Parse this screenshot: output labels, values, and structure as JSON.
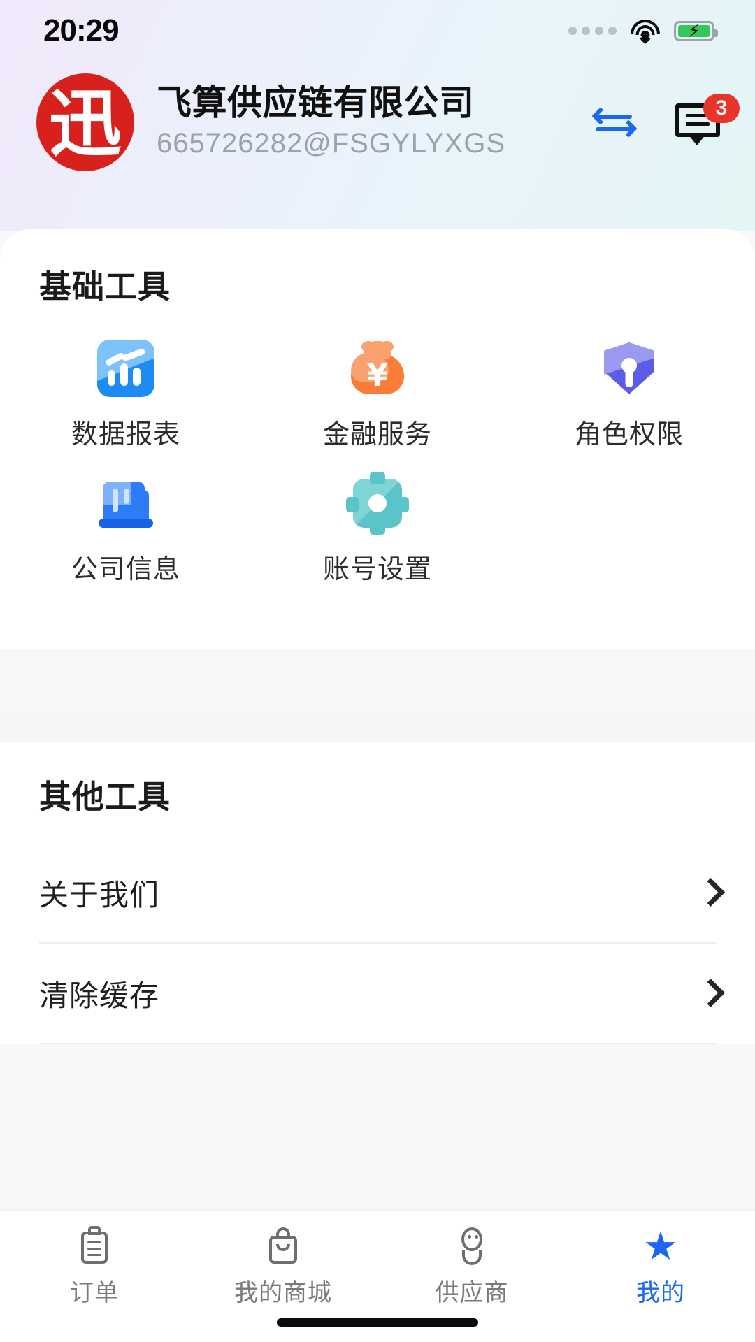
{
  "status_bar": {
    "time": "20:29",
    "signal_icon": "signal-dots-icon",
    "wifi_icon": "wifi-icon",
    "battery_icon": "battery-charging-icon"
  },
  "header": {
    "logo_icon": "company-logo-icon",
    "logo_glyph": "迅",
    "logo_color": "#d8211c",
    "company_name": "飞算供应链有限公司",
    "account_id": "665726282@FSGYLYXGS",
    "switch_icon": "switch-account-icon",
    "switch_color": "#1a68f0",
    "message_icon": "message-icon",
    "message_badge": "3",
    "badge_color": "#e8342a"
  },
  "basic_tools": {
    "title": "基础工具",
    "items": [
      {
        "label": "数据报表",
        "icon": "chart-report-icon",
        "color": "#1e8bf5"
      },
      {
        "label": "金融服务",
        "icon": "money-bag-icon",
        "color": "#f97c37"
      },
      {
        "label": "角色权限",
        "icon": "shield-lock-icon",
        "color": "#5c5ce8"
      },
      {
        "label": "公司信息",
        "icon": "building-icon",
        "color": "#2b7cf6"
      },
      {
        "label": "账号设置",
        "icon": "gear-icon",
        "color": "#5bc4c8"
      }
    ]
  },
  "other_tools": {
    "title": "其他工具",
    "items": [
      {
        "label": "关于我们",
        "chevron": "chevron-right-icon"
      },
      {
        "label": "清除缓存",
        "chevron": "chevron-right-icon"
      }
    ]
  },
  "tabbar": {
    "active_color": "#1a68f0",
    "inactive_color": "#7a7a7a",
    "items": [
      {
        "label": "订单",
        "icon": "clipboard-icon",
        "active": false
      },
      {
        "label": "我的商城",
        "icon": "shopping-bag-icon",
        "active": false
      },
      {
        "label": "供应商",
        "icon": "supplier-person-icon",
        "active": false
      },
      {
        "label": "我的",
        "icon": "star-icon",
        "active": true
      }
    ]
  }
}
